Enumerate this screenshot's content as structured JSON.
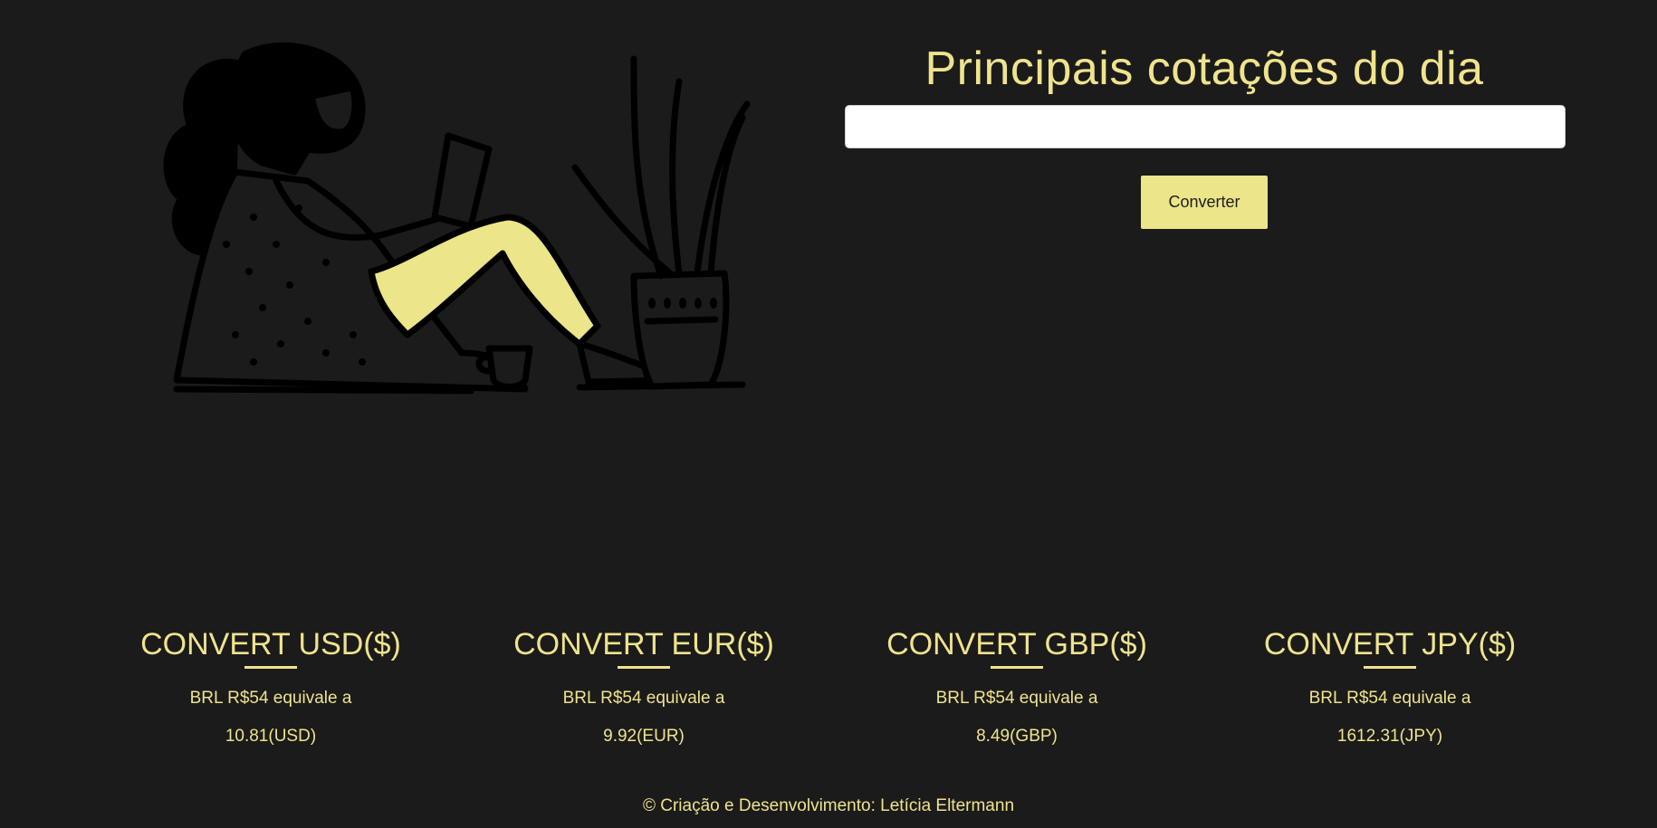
{
  "hero": {
    "title": "Principais cotações do dia",
    "input_value": "",
    "input_placeholder": "",
    "button_label": "Converter"
  },
  "illustration": {
    "icon": "woman-reading-illustration",
    "accent_color": "#ece589"
  },
  "cards": [
    {
      "title": "CONVERT USD($)",
      "text": "BRL R$54 equivale a",
      "value": "10.81(USD)"
    },
    {
      "title": "CONVERT EUR($)",
      "text": "BRL R$54 equivale a",
      "value": "9.92(EUR)"
    },
    {
      "title": "CONVERT GBP($)",
      "text": "BRL R$54 equivale a",
      "value": "8.49(GBP)"
    },
    {
      "title": "CONVERT JPY($)",
      "text": "BRL R$54 equivale a",
      "value": "1612.31(JPY)"
    }
  ],
  "footer": {
    "text": "© Criação e Desenvolvimento: Letícia Eltermann"
  },
  "colors": {
    "background": "#1b1b1b",
    "accent": "#efe38d",
    "button": "#ece589"
  }
}
